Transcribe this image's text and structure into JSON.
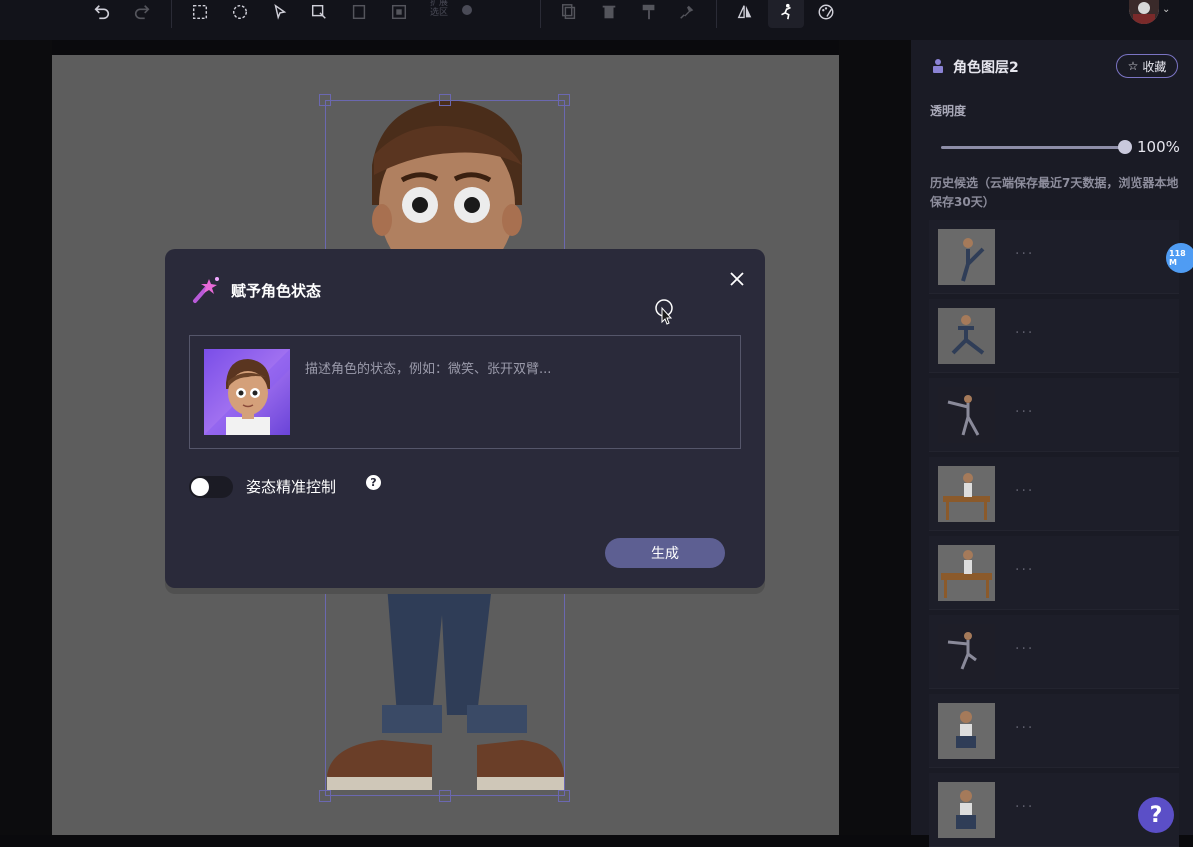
{
  "toolbar": {
    "buttons": [
      {
        "name": "undo-icon"
      },
      {
        "name": "redo-icon"
      },
      {
        "name": "rect-select-icon"
      },
      {
        "name": "lasso-select-icon"
      },
      {
        "name": "smart-select-icon"
      },
      {
        "name": "brush-select-icon"
      },
      {
        "name": "invert-select-icon"
      },
      {
        "name": "crop-select-icon"
      },
      {
        "name": "copy-icon"
      },
      {
        "name": "delete-icon"
      },
      {
        "name": "paint-roller-icon"
      },
      {
        "name": "pin-icon"
      },
      {
        "name": "flip-icon"
      },
      {
        "name": "pose-icon"
      },
      {
        "name": "palette-icon"
      }
    ],
    "expand_label": "扩展\n选区"
  },
  "dialog": {
    "title": "赋予角色状态",
    "prompt_placeholder": "描述角色的状态，例如：微笑、张开双臂...",
    "toggle_label": "姿态精准控制",
    "toggle_on": false,
    "help_label": "?",
    "generate_label": "生成"
  },
  "panel": {
    "layer_name": "角色图层2",
    "favorite_label": "收藏",
    "opacity_label": "透明度",
    "opacity_value": "100%",
    "opacity_fraction": 1.0,
    "history_label": "历史候选（云端保存最近7天数据，浏览器本地保存30天）",
    "history_items": [
      {
        "dots": "···"
      },
      {
        "dots": "···"
      },
      {
        "dots": "···"
      },
      {
        "dots": "···"
      },
      {
        "dots": "···"
      },
      {
        "dots": "···"
      },
      {
        "dots": "···"
      },
      {
        "dots": "···"
      }
    ]
  },
  "badge": "118 M",
  "help_fab": "?",
  "colors": {
    "accent": "#5d5f92",
    "panel_bg": "#1a1b25",
    "dialog_bg": "#2a2a3a",
    "selection": "#6b68b0",
    "badge": "#4f9cf3",
    "fab": "#5b4fc7"
  }
}
